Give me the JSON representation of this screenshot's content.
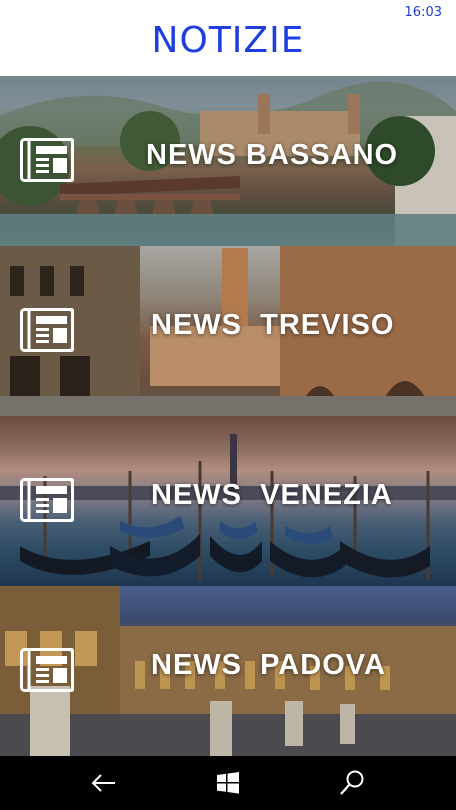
{
  "status_bar": {
    "time": "16:03"
  },
  "header": {
    "title": "NOTIZIE",
    "title_color": "#1e3ee0"
  },
  "tiles": [
    {
      "label": "NEWS BASSANO",
      "icon": "newspaper-icon",
      "background": "bassano-bridge-photo"
    },
    {
      "label": "NEWS  TREVISO",
      "icon": "newspaper-icon",
      "background": "treviso-square-photo"
    },
    {
      "label": "NEWS  VENEZIA",
      "icon": "newspaper-icon",
      "background": "venezia-gondolas-photo"
    },
    {
      "label": "NEWS  PADOVA",
      "icon": "newspaper-icon",
      "background": "padova-prato-photo"
    }
  ],
  "nav_bar": {
    "back_icon": "back-arrow-icon",
    "home_icon": "windows-logo-icon",
    "search_icon": "search-icon"
  }
}
